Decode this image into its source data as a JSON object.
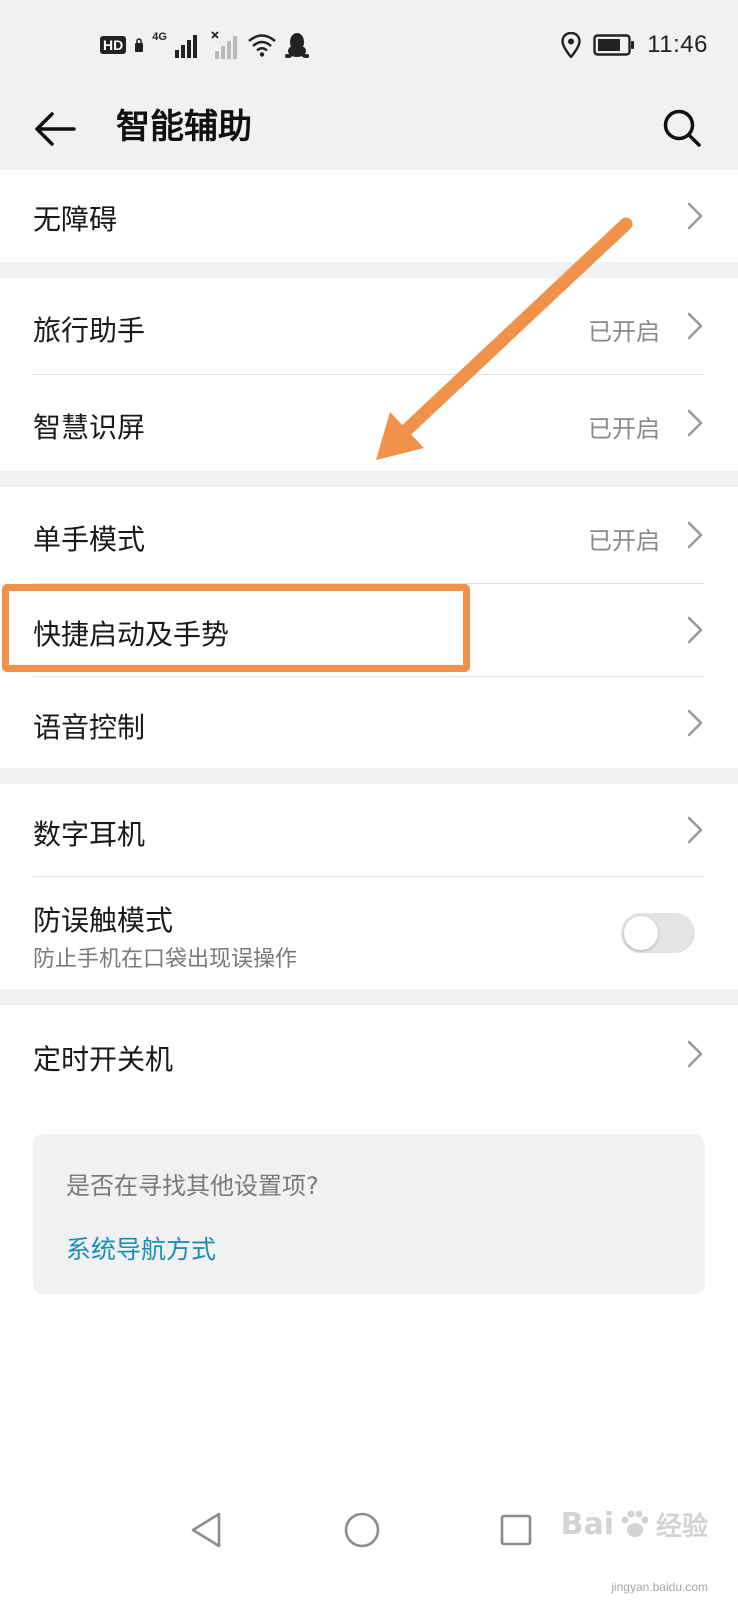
{
  "status_bar": {
    "hd_badge": "HD",
    "network_type": "4G",
    "time": "11:46"
  },
  "header": {
    "title": "智能辅助",
    "back_icon": "arrow-left-icon",
    "search_icon": "search-icon"
  },
  "settings": {
    "accessibility": {
      "label": "无障碍"
    },
    "travel_assistant": {
      "label": "旅行助手",
      "status": "已开启"
    },
    "smart_screen_recognition": {
      "label": "智慧识屏",
      "status": "已开启"
    },
    "one_hand_mode": {
      "label": "单手模式",
      "status": "已开启"
    },
    "shortcuts_gestures": {
      "label": "快捷启动及手势"
    },
    "voice_control": {
      "label": "语音控制"
    },
    "digital_earphone": {
      "label": "数字耳机"
    },
    "pocket_mode": {
      "label": "防误触模式",
      "subtitle": "防止手机在口袋出现误操作",
      "enabled": false
    },
    "scheduled_power": {
      "label": "定时开关机"
    }
  },
  "suggestion": {
    "question": "是否在寻找其他设置项?",
    "link": "系统导航方式"
  },
  "nav_bar": {
    "back_icon": "triangle-back-icon",
    "home_icon": "circle-home-icon",
    "recents_icon": "square-recents-icon"
  },
  "watermark": {
    "text": "Bai",
    "cn": "经验",
    "sub": "jingyan.baidu.com"
  },
  "colors": {
    "annotation": "#f0924a",
    "link": "#1a8fb3",
    "background_gray": "#f1f1f3"
  }
}
